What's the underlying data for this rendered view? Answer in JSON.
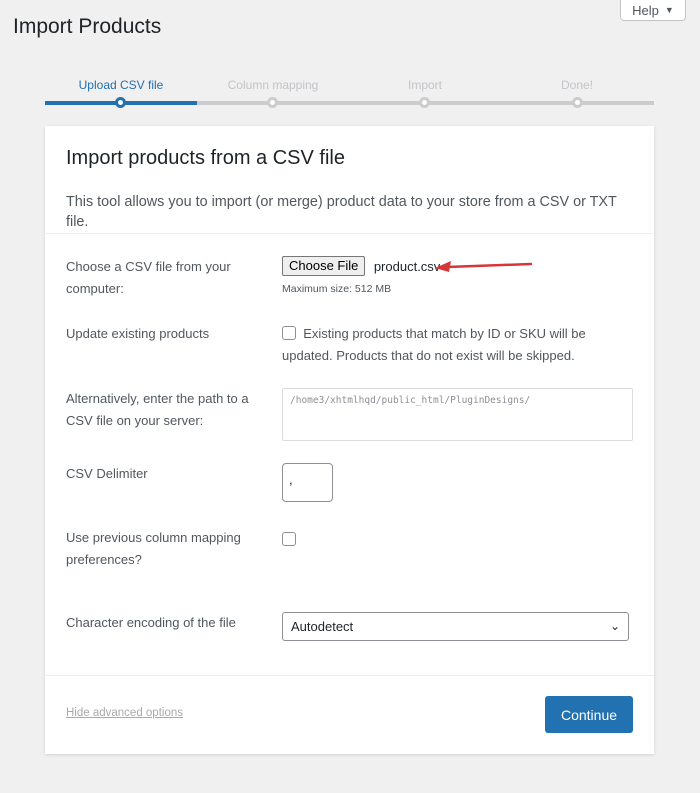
{
  "help": {
    "label": "Help",
    "caret": "▼"
  },
  "page_title": "Import Products",
  "steps": [
    {
      "label": "Upload CSV file",
      "active": true
    },
    {
      "label": "Column mapping",
      "active": false
    },
    {
      "label": "Import",
      "active": false
    },
    {
      "label": "Done!",
      "active": false
    }
  ],
  "card": {
    "title": "Import products from a CSV file",
    "description": "This tool allows you to import (or merge) product data to your store from a CSV or TXT file."
  },
  "fields": {
    "file": {
      "label": "Choose a CSV file from your computer:",
      "button": "Choose File",
      "filename": "product.csv",
      "max_size": "Maximum size: 512 MB"
    },
    "update": {
      "label": "Update existing products",
      "text": "Existing products that match by ID or SKU will be updated. Products that do not exist will be skipped."
    },
    "path": {
      "label": "Alternatively, enter the path to a CSV file on your server:",
      "placeholder": "/home3/xhtmlhqd/public_html/PluginDesigns/"
    },
    "delimiter": {
      "label": "CSV Delimiter",
      "value": ","
    },
    "mapping": {
      "label": "Use previous column mapping preferences?"
    },
    "encoding": {
      "label": "Character encoding of the file",
      "value": "Autodetect",
      "chevron": "⌄"
    }
  },
  "footer": {
    "hide_link": "Hide advanced options",
    "continue": "Continue"
  },
  "colors": {
    "accent": "#2271b1",
    "arrow": "#d63638"
  }
}
